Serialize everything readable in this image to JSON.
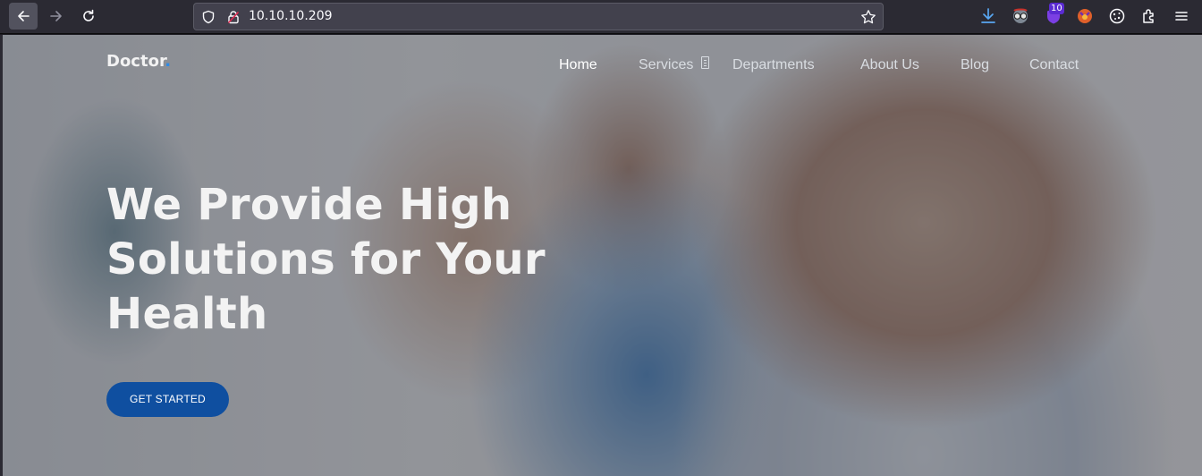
{
  "browser": {
    "url": "10.10.10.209",
    "extension_badge": "10",
    "icons": [
      "back-icon",
      "forward-icon",
      "reload-icon",
      "shield-icon",
      "lock-icon",
      "bookmark-star-icon",
      "download-icon",
      "privacy-mask-icon",
      "ublock-icon",
      "fox-extension-icon",
      "cookie-icon",
      "extensions-puzzle-icon",
      "hamburger-menu-icon"
    ]
  },
  "site": {
    "logo": "Doctor",
    "logo_dot": ".",
    "nav": {
      "home": "Home",
      "services": "Services",
      "departments": "Departments",
      "about": "About Us",
      "blog": "Blog",
      "contact": "Contact"
    },
    "hero": {
      "line1": "We Provide High",
      "line2": "Solutions for Your",
      "line3": "Health"
    },
    "cta": "GET STARTED"
  },
  "colors": {
    "accent_dot": "#2d8be7",
    "cta_bg": "#0f4fa0",
    "chrome_bg": "#2b2a33",
    "badge": "#5b2bd2"
  }
}
